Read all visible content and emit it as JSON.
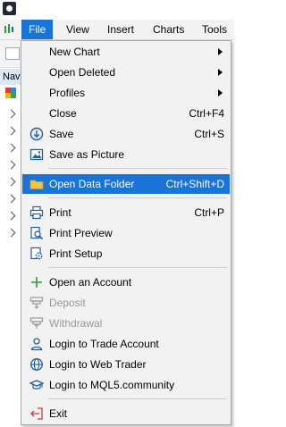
{
  "menubar": {
    "items": [
      {
        "label": "File",
        "active": true
      },
      {
        "label": "View"
      },
      {
        "label": "Insert"
      },
      {
        "label": "Charts"
      },
      {
        "label": "Tools"
      }
    ]
  },
  "navigator": {
    "header_label": "Nav"
  },
  "file_menu": {
    "items": [
      {
        "label": "New Chart",
        "shortcut": "",
        "submenu": true
      },
      {
        "label": "Open Deleted",
        "shortcut": "",
        "submenu": true
      },
      {
        "label": "Profiles",
        "shortcut": "",
        "submenu": true
      },
      {
        "label": "Close",
        "shortcut": "Ctrl+F4"
      },
      {
        "label": "Save",
        "shortcut": "Ctrl+S",
        "icon": "save-icon"
      },
      {
        "label": "Save as Picture",
        "shortcut": "",
        "icon": "picture-icon"
      },
      {
        "label": "Open Data Folder",
        "shortcut": "Ctrl+Shift+D",
        "icon": "folder-icon",
        "highlighted": true
      },
      {
        "label": "Print",
        "shortcut": "Ctrl+P",
        "icon": "printer-icon"
      },
      {
        "label": "Print Preview",
        "shortcut": "",
        "icon": "print-preview-icon"
      },
      {
        "label": "Print Setup",
        "shortcut": "",
        "icon": "print-setup-icon"
      },
      {
        "label": "Open an Account",
        "shortcut": "",
        "icon": "plus-icon"
      },
      {
        "label": "Deposit",
        "shortcut": "",
        "icon": "deposit-icon",
        "disabled": true
      },
      {
        "label": "Withdrawal",
        "shortcut": "",
        "icon": "withdrawal-icon",
        "disabled": true
      },
      {
        "label": "Login to Trade Account",
        "shortcut": "",
        "icon": "user-icon"
      },
      {
        "label": "Login to Web Trader",
        "shortcut": "",
        "icon": "globe-icon"
      },
      {
        "label": "Login to MQL5.community",
        "shortcut": "",
        "icon": "graduation-cap-icon"
      },
      {
        "label": "Exit",
        "shortcut": "",
        "icon": "exit-icon"
      }
    ]
  },
  "colors": {
    "highlight": "#1a73d6",
    "menu_background": "#f2f2f2",
    "icon_blue": "#1f5fa8",
    "plus_green": "#2e9b3a",
    "exit_red": "#d23a3a",
    "folder_yellow": "#f4c542"
  }
}
